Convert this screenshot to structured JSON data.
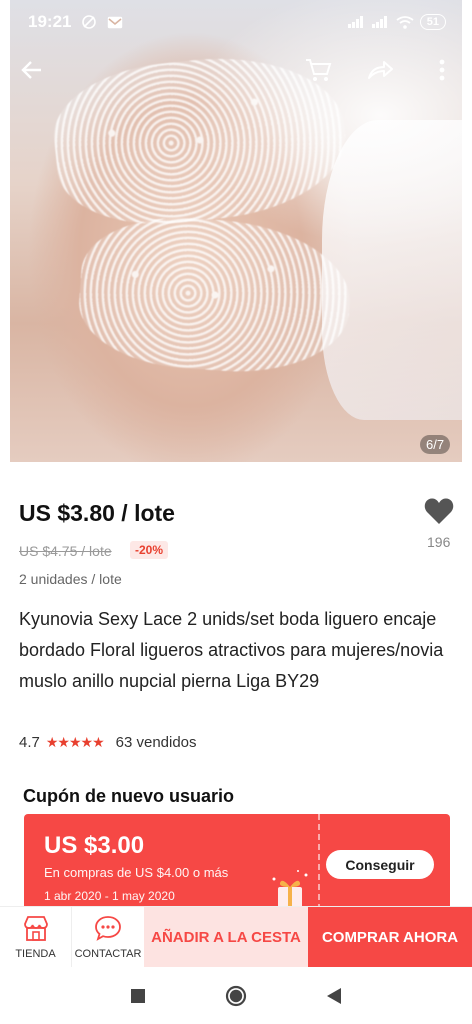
{
  "status_bar": {
    "time": "19:21",
    "battery": "51"
  },
  "gallery": {
    "counter": "6/7"
  },
  "product": {
    "price": "US $3.80 / lote",
    "old_price": "US $4.75 / lote",
    "discount": "-20%",
    "wish_count": "196",
    "unit": "2 unidades / lote",
    "title": "Kyunovia Sexy Lace 2 unids/set boda liguero encaje bordado Floral ligueros atractivos para mujeres/novia muslo anillo nupcial pierna Liga BY29",
    "rating": "4.7",
    "stars": "★★★★★",
    "sold": "63 vendidos"
  },
  "coupon": {
    "heading": "Cupón de nuevo usuario",
    "amount": "US $3.00",
    "condition": "En compras de US $4.00 o más",
    "dates": "1 abr 2020 - 1 may 2020",
    "button": "Conseguir"
  },
  "action_bar": {
    "store_label": "TIENDA",
    "contact_label": "CONTACTAR",
    "add_to_cart": "AÑADIR A LA CESTA",
    "buy_now": "COMPRAR AHORA"
  },
  "colors": {
    "accent": "#f64845",
    "accent_light": "#fde3e1",
    "star": "#e8402f"
  }
}
